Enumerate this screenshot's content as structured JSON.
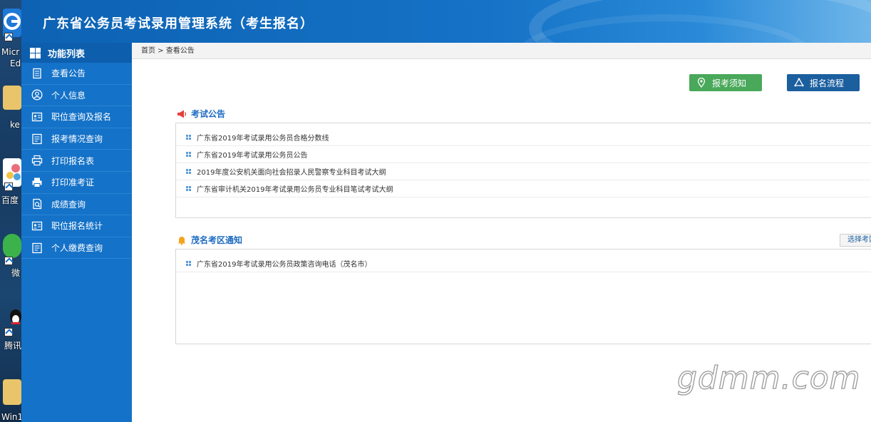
{
  "desktop": {
    "icons": [
      {
        "label": "Micr",
        "sub": "Ed",
        "name": "edge-icon"
      },
      {
        "label": "ke",
        "name": "folder-icon"
      },
      {
        "label": "百度",
        "name": "baidu-icon"
      },
      {
        "label": "微",
        "name": "wechat-icon"
      },
      {
        "label": "腾讯",
        "name": "qq-icon"
      },
      {
        "label": "Win1",
        "name": "folder-icon"
      }
    ]
  },
  "header": {
    "title": "广东省公务员考试录用管理系统（考生报名）"
  },
  "sidebar": {
    "heading": "功能列表",
    "items": [
      {
        "label": "查看公告",
        "icon": "document-icon"
      },
      {
        "label": "个人信息",
        "icon": "user-icon"
      },
      {
        "label": "职位查询及报名",
        "icon": "id-card-icon"
      },
      {
        "label": "报考情况查询",
        "icon": "list-icon"
      },
      {
        "label": "打印报名表",
        "icon": "printer-icon"
      },
      {
        "label": "打印准考证",
        "icon": "printer-icon"
      },
      {
        "label": "成绩查询",
        "icon": "score-icon"
      },
      {
        "label": "职位报名统计",
        "icon": "id-card-icon"
      },
      {
        "label": "个人缴费查询",
        "icon": "list-icon"
      }
    ]
  },
  "breadcrumb": {
    "text": "首页 > 查看公告"
  },
  "buttons": {
    "notice": "报考须知",
    "process": "报名流程"
  },
  "exam_notice": {
    "title": "考试公告",
    "items": [
      "广东省2019年考试录用公务员合格分数线",
      "广东省2019年考试录用公务员公告",
      "2019年度公安机关面向社会招录人民警察专业科目考试大纲",
      "广东省审计机关2019年考试录用公务员专业科目笔试考试大纲"
    ]
  },
  "region_notice": {
    "title": "茂名考区通知",
    "select_label": "选择考区",
    "items": [
      "广东省2019年考试录用公务员政策咨询电话（茂名市）"
    ]
  },
  "watermark": "gdmm.com",
  "colors": {
    "header": "#1572c6",
    "sidebar": "#1472c8",
    "green_button": "#49a85a",
    "blue_button": "#1b5f9f"
  }
}
